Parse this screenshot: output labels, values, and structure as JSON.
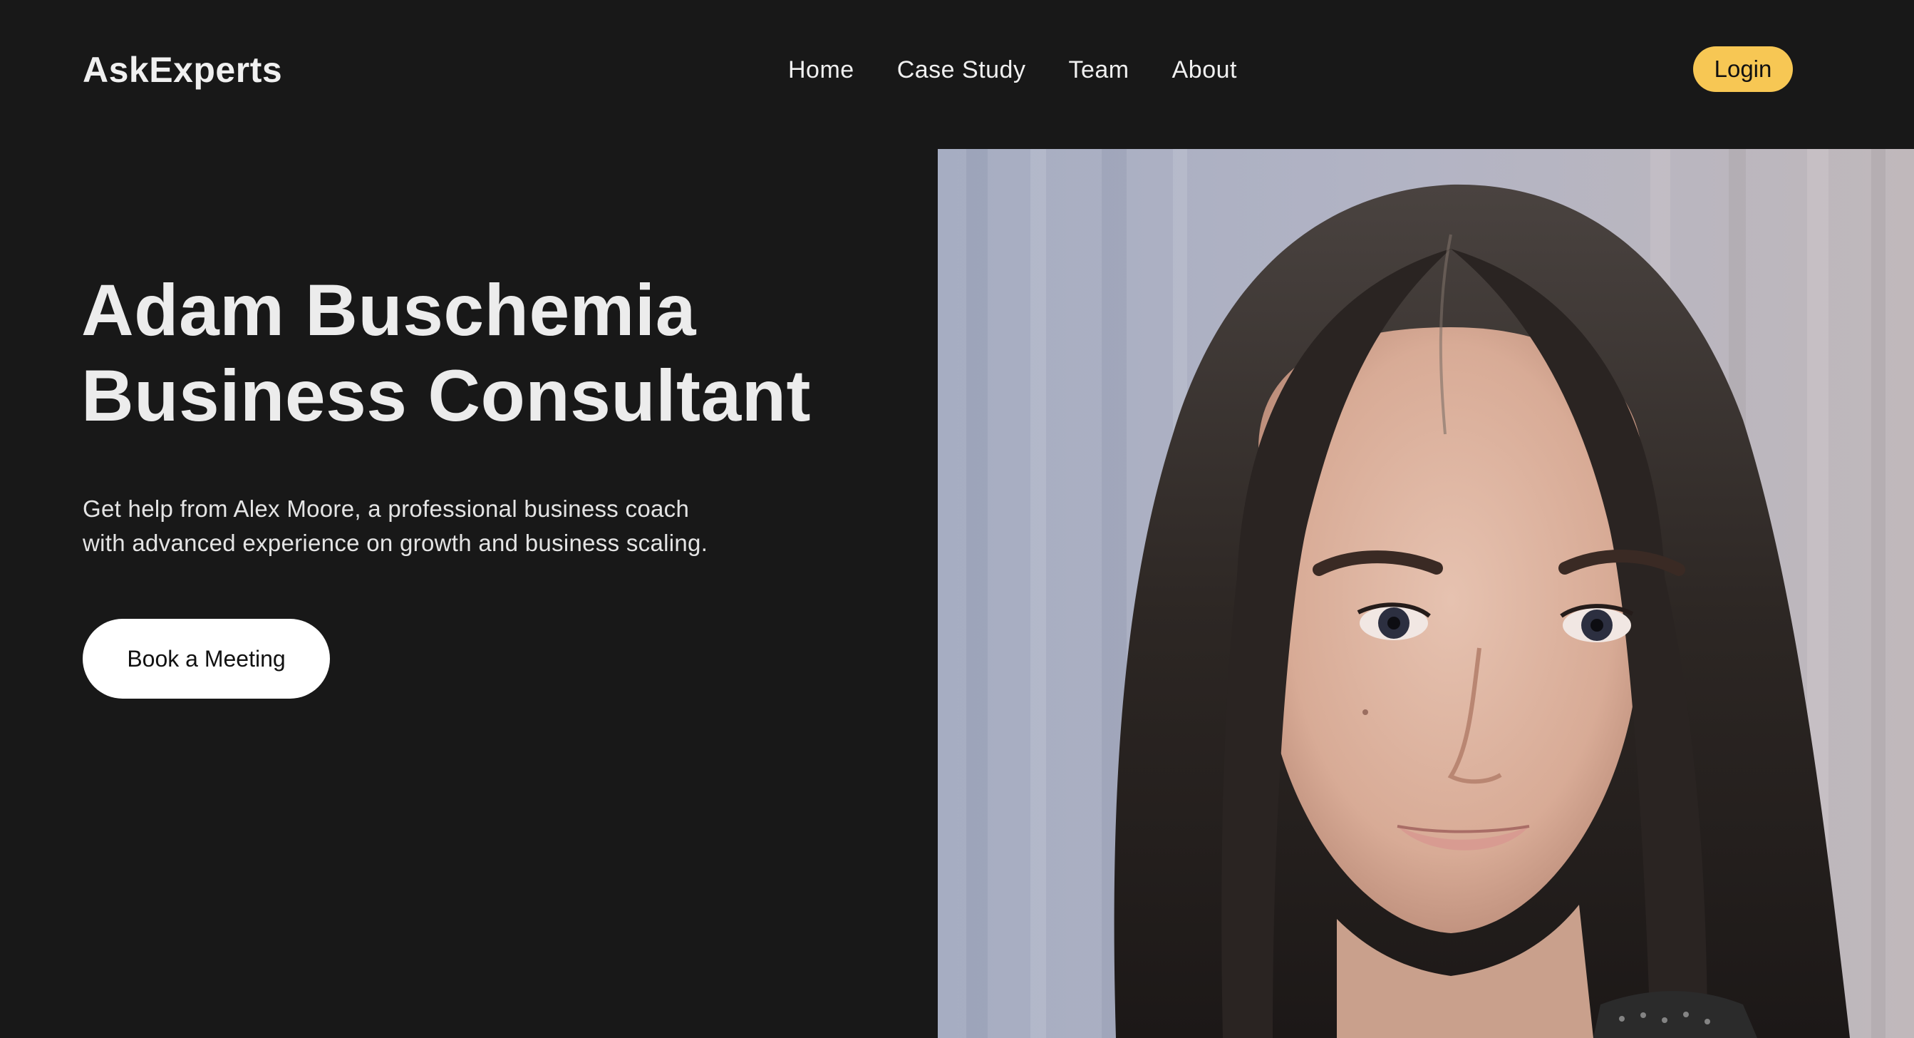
{
  "brand": {
    "name": "AskExperts"
  },
  "nav": {
    "items": [
      {
        "label": "Home"
      },
      {
        "label": "Case Study"
      },
      {
        "label": "Team"
      },
      {
        "label": "About"
      }
    ],
    "login_label": "Login"
  },
  "hero": {
    "title_line1": "Adam Buschemia",
    "title_line2": "Business Consultant",
    "description": "Get help from Alex Moore, a professional business coach with advanced experience on growth and business scaling.",
    "cta_label": "Book a Meeting"
  },
  "colors": {
    "background": "#181818",
    "accent": "#f7c754",
    "text": "#f2f2f2"
  }
}
